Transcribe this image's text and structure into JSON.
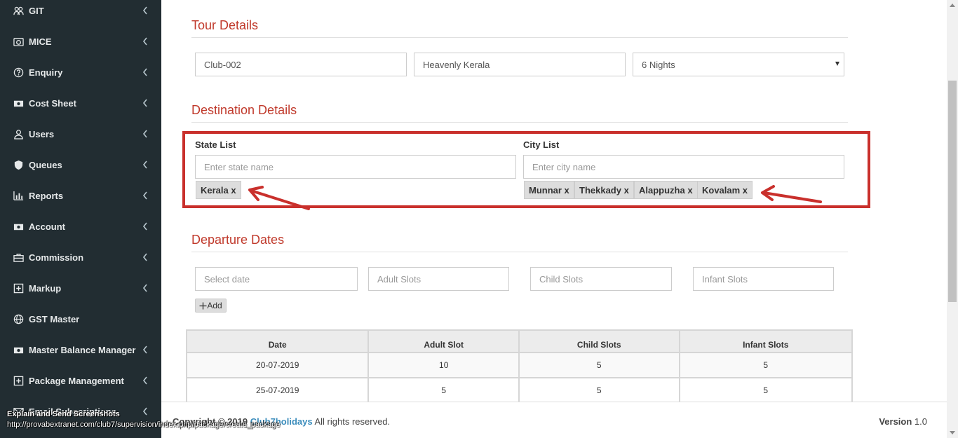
{
  "sidebar": {
    "items": [
      {
        "label": "GIT",
        "icon": "group-icon"
      },
      {
        "label": "MICE",
        "icon": "camera-icon"
      },
      {
        "label": "Enquiry",
        "icon": "question-icon"
      },
      {
        "label": "Cost Sheet",
        "icon": "money-icon"
      },
      {
        "label": "Users",
        "icon": "user-icon"
      },
      {
        "label": "Queues",
        "icon": "shield-icon"
      },
      {
        "label": "Reports",
        "icon": "bar-chart-icon"
      },
      {
        "label": "Account",
        "icon": "money-icon"
      },
      {
        "label": "Commission",
        "icon": "briefcase-icon"
      },
      {
        "label": "Markup",
        "icon": "plus-square-icon"
      },
      {
        "label": "GST Master",
        "icon": "globe-icon"
      },
      {
        "label": "Master Balance Manager",
        "icon": "money-icon"
      },
      {
        "label": "Package Management",
        "icon": "plus-square-icon"
      },
      {
        "label": "Email Subscriptions",
        "icon": "envelope-icon"
      }
    ]
  },
  "status_overlay": {
    "title": "Explain and Send Screenshots",
    "url": "http://provabextranet.com/club7/supervision/index.php/package/create_package"
  },
  "tour": {
    "title": "Tour Details",
    "code": "Club-002",
    "name": "Heavenly Kerala",
    "nights": "6 Nights"
  },
  "destination": {
    "title": "Destination Details",
    "state_label": "State List",
    "state_placeholder": "Enter state name",
    "states": [
      "Kerala x"
    ],
    "city_label": "City List",
    "city_placeholder": "Enter city name",
    "cities": [
      "Munnar x",
      "Thekkady x",
      "Alappuzha x",
      "Kovalam x"
    ]
  },
  "departure": {
    "title": "Departure Dates",
    "date_placeholder": "Select date",
    "adult_placeholder": "Adult Slots",
    "child_placeholder": "Child Slots",
    "infant_placeholder": "Infant Slots",
    "add_label": "Add",
    "table": {
      "headers": [
        "Date",
        "Adult Slot",
        "Child Slots",
        "Infant Slots"
      ],
      "rows": [
        [
          "20-07-2019",
          "10",
          "5",
          "5"
        ],
        [
          "25-07-2019",
          "5",
          "5",
          "5"
        ]
      ]
    }
  },
  "footer": {
    "copyright": "Copyright © 2019",
    "brand": "Club7holidays",
    "rights": "All rights reserved.",
    "version_label": "Version",
    "version": "1.0"
  },
  "colors": {
    "sidebar_bg": "#222d32",
    "accent_red": "#c0392b",
    "highlight_red": "#c9302c",
    "brand_link": "#3c8dbc"
  }
}
